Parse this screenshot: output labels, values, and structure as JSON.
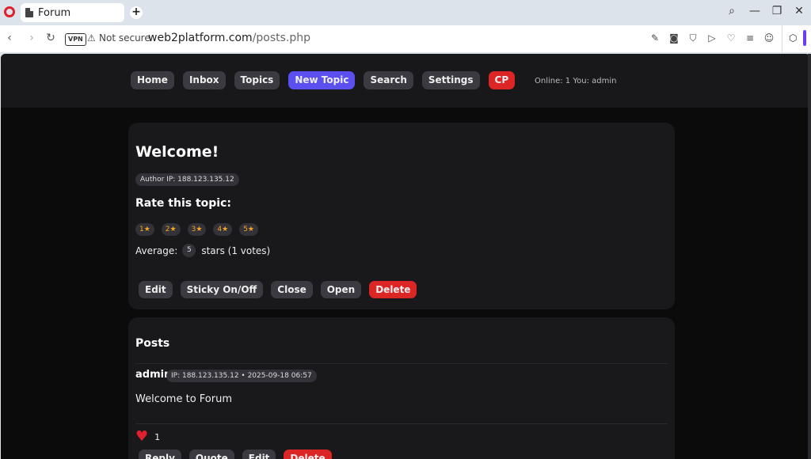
{
  "browser": {
    "tab_title": "Forum",
    "new_tab": "+",
    "window": {
      "search": "⌕",
      "minimize": "—",
      "restore": "❐",
      "close": "✕"
    },
    "nav": {
      "back": "‹",
      "forward": "›",
      "reload": "↻"
    },
    "vpn": "VPN",
    "security_label": "Not secure",
    "url_domain": "web2platform.com",
    "url_path": "/posts.php",
    "icons": [
      "edit-icon",
      "camera-icon",
      "shield-icon",
      "play-icon",
      "heart-icon",
      "menu-icon",
      "profile-icon"
    ],
    "accent": "#6b3df0"
  },
  "topnav": {
    "items": [
      {
        "label": "Home",
        "style": "default"
      },
      {
        "label": "Inbox",
        "style": "default"
      },
      {
        "label": "Topics",
        "style": "default"
      },
      {
        "label": "New Topic",
        "style": "primary"
      },
      {
        "label": "Search",
        "style": "default"
      },
      {
        "label": "Settings",
        "style": "default"
      },
      {
        "label": "CP",
        "style": "danger"
      }
    ],
    "status": "Online: 1 You: admin"
  },
  "topic": {
    "title": "Welcome!",
    "author_ip": "Author IP: 188.123.135.12",
    "rate_label": "Rate this topic:",
    "stars": [
      "1★",
      "2★",
      "3★",
      "4★",
      "5★"
    ],
    "average_prefix": "Average:",
    "average_value": "5",
    "average_suffix": "stars (1 votes)",
    "actions": [
      {
        "label": "Edit",
        "style": "default"
      },
      {
        "label": "Sticky On/Off",
        "style": "default"
      },
      {
        "label": "Close",
        "style": "default"
      },
      {
        "label": "Open",
        "style": "default"
      },
      {
        "label": "Delete",
        "style": "danger"
      }
    ]
  },
  "posts": {
    "heading": "Posts",
    "items": [
      {
        "author": "admin",
        "meta": "IP: 188.123.135.12 • 2025-09-18 06:57",
        "body": "Welcome to Forum",
        "likes": "1",
        "actions": [
          {
            "label": "Reply",
            "style": "default"
          },
          {
            "label": "Quote",
            "style": "default"
          },
          {
            "label": "Edit",
            "style": "default"
          },
          {
            "label": "Delete",
            "style": "danger"
          }
        ]
      }
    ]
  },
  "colors": {
    "primary": "#5b4ff0",
    "danger": "#dc2626",
    "star": "#f5a623"
  }
}
